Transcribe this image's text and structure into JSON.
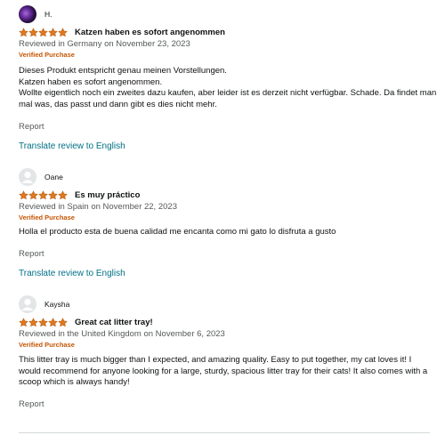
{
  "reviews": [
    {
      "reviewer": "H.",
      "rating": 5,
      "title": "Katzen haben es sofort angenommen",
      "meta": "Reviewed in Germany on November 23, 2023",
      "verified": "Verified Purchase",
      "body": [
        "Dieses Produkt entspricht genau meinen Vorstellungen.",
        "Katzen haben es sofort angenommen.",
        "Wollte eigentlich noch ein zweites dazu kaufen, aber leider ist es derzeit nicht verfügbar. Schade. Da findet man mal was, das passt und dann gibt es dies nicht mehr."
      ],
      "report": "Report",
      "translate": "Translate review to English"
    },
    {
      "reviewer": "Oane",
      "rating": 5,
      "title": "Es muy práctico",
      "meta": "Reviewed in Spain on November 22, 2023",
      "verified": "Verified Purchase",
      "body": [
        "Holla el producto esta de buena calidad me encanta como mi gato lo disfruta a gusto"
      ],
      "report": "Report",
      "translate": "Translate review to English"
    },
    {
      "reviewer": "Kaysha",
      "rating": 5,
      "title": "Great cat litter tray!",
      "meta": "Reviewed in the United Kingdom on November 6, 2023",
      "verified": "Verified Purchase",
      "body": [
        "This litter tray is much bigger than I expected, and amazing quality. Easy to put together, my cat loves it! I would recommend for anyone looking for a large, sturdy, spacious litter tray for their cats! It also comes with a scoop which is always handy!"
      ],
      "report": "Report"
    }
  ],
  "colors": {
    "star": "#de7921",
    "verified": "#c45500",
    "link": "#007185",
    "meta": "#565959"
  }
}
